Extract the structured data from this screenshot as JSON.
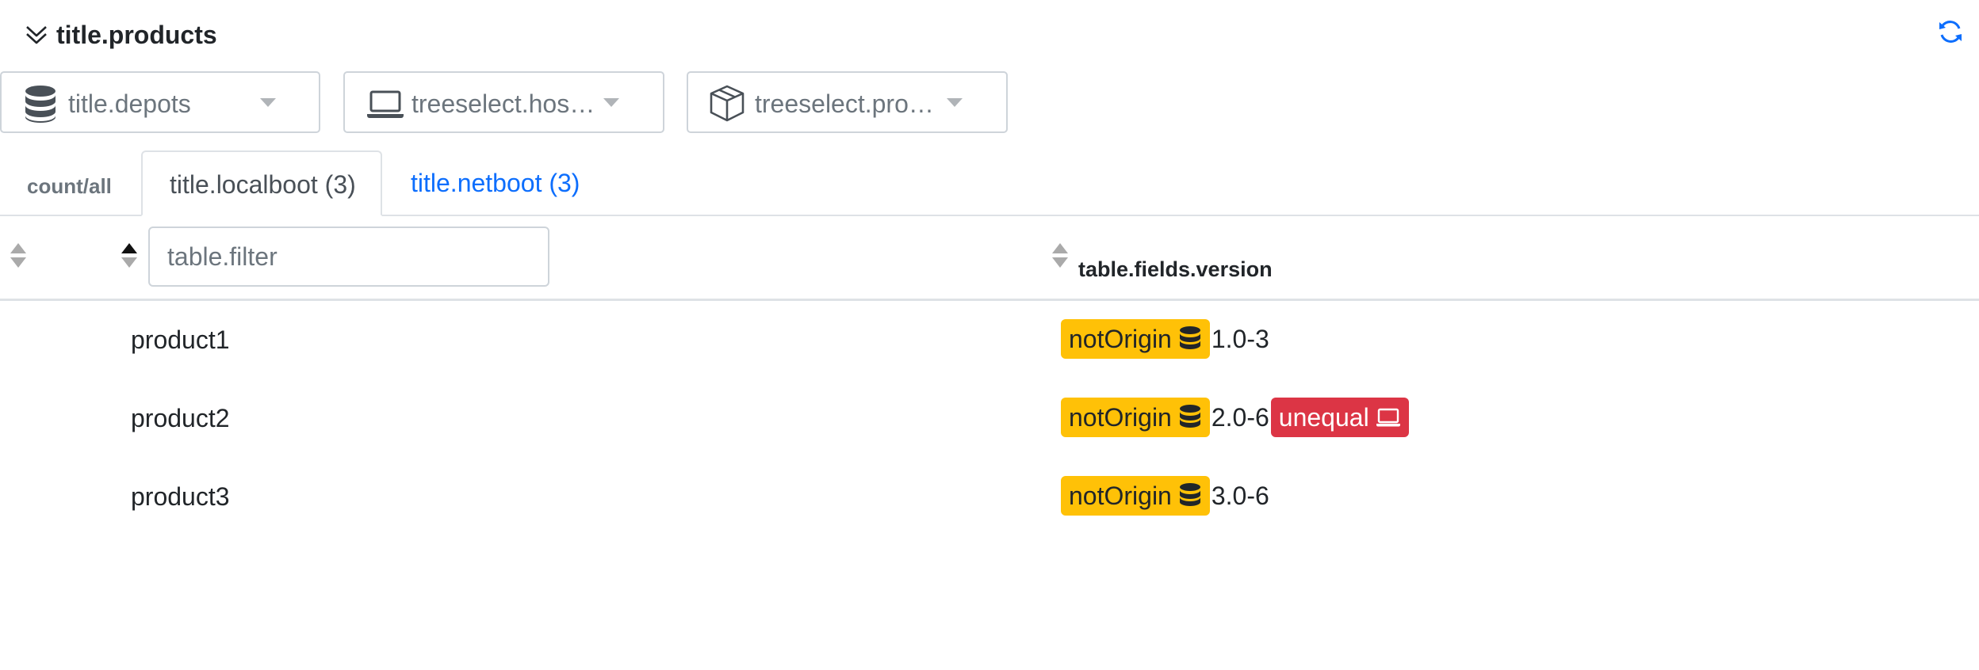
{
  "header": {
    "title": "title.products"
  },
  "selects": {
    "depots": {
      "label": "title.depots",
      "icon": "database-icon"
    },
    "hosts": {
      "label": "treeselect.hos…",
      "icon": "laptop-icon"
    },
    "products": {
      "label": "treeselect.pro…",
      "icon": "box-icon"
    }
  },
  "tabs": {
    "count_label": "count/all",
    "active": "title.localboot (3)",
    "other": "title.netboot (3)"
  },
  "table": {
    "filter_placeholder": "table.filter",
    "version_header": "table.fields.version",
    "rows": [
      {
        "name": "product1",
        "badge": "notOrigin",
        "version": "1.0-3",
        "extra": ""
      },
      {
        "name": "product2",
        "badge": "notOrigin",
        "version": "2.0-6",
        "extra": "unequal"
      },
      {
        "name": "product3",
        "badge": "notOrigin",
        "version": "3.0-6",
        "extra": ""
      }
    ]
  },
  "colors": {
    "warning": "#ffc107",
    "danger": "#dc3545",
    "link": "#0d6efd",
    "refresh": "#0d6efd"
  }
}
